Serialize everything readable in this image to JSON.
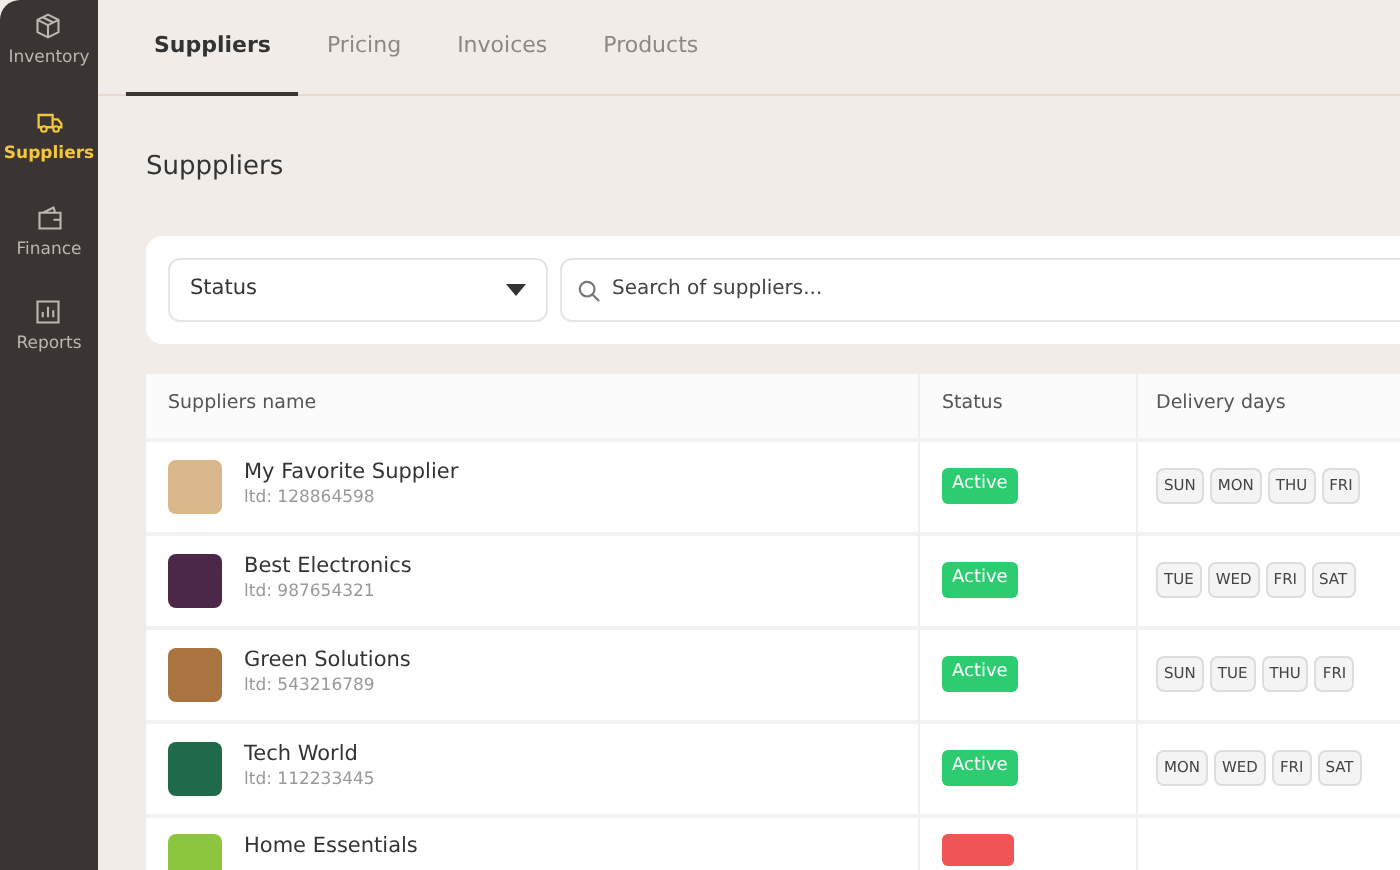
{
  "sidebar": {
    "items": [
      {
        "label": "Inventory",
        "selected": false
      },
      {
        "label": "Suppliers",
        "selected": true
      },
      {
        "label": "Finance",
        "selected": false
      },
      {
        "label": "Reports",
        "selected": false
      }
    ]
  },
  "tabs": [
    {
      "label": "Suppliers",
      "selected": true
    },
    {
      "label": "Pricing",
      "selected": false
    },
    {
      "label": "Invoices",
      "selected": false
    },
    {
      "label": "Products",
      "selected": false
    }
  ],
  "page_title": "Supppliers",
  "filters": {
    "status_select": "Status",
    "search": {
      "placeholder": "Search of suppliers..."
    }
  },
  "table": {
    "columns": [
      "Suppliers name",
      "Status",
      "Delivery days"
    ],
    "rows": [
      {
        "name": "My Favorite Supplier",
        "id": "ltd: 128864598",
        "color": "#d8b88a",
        "status": {
          "kind": "active",
          "label": "Active"
        },
        "days": [
          "SUN",
          "MON",
          "THU",
          "FRI"
        ]
      },
      {
        "name": "Best Electronics",
        "id": "ltd: 987654321",
        "color": "#4b2748",
        "status": {
          "kind": "active",
          "label": "Active"
        },
        "days": [
          "TUE",
          "WED",
          "FRI",
          "SAT"
        ]
      },
      {
        "name": "Green Solutions",
        "id": "ltd: 543216789",
        "color": "#a9743f",
        "status": {
          "kind": "active",
          "label": "Active"
        },
        "days": [
          "SUN",
          "TUE",
          "THU",
          "FRI"
        ]
      },
      {
        "name": "Tech World",
        "id": "ltd: 112233445",
        "color": "#1f6a4a",
        "status": {
          "kind": "active",
          "label": "Active"
        },
        "days": [
          "MON",
          "WED",
          "FRI",
          "SAT"
        ]
      },
      {
        "name": "Home Essentials",
        "color": "#8cc63f",
        "status": {
          "kind": "inactive"
        }
      }
    ]
  }
}
